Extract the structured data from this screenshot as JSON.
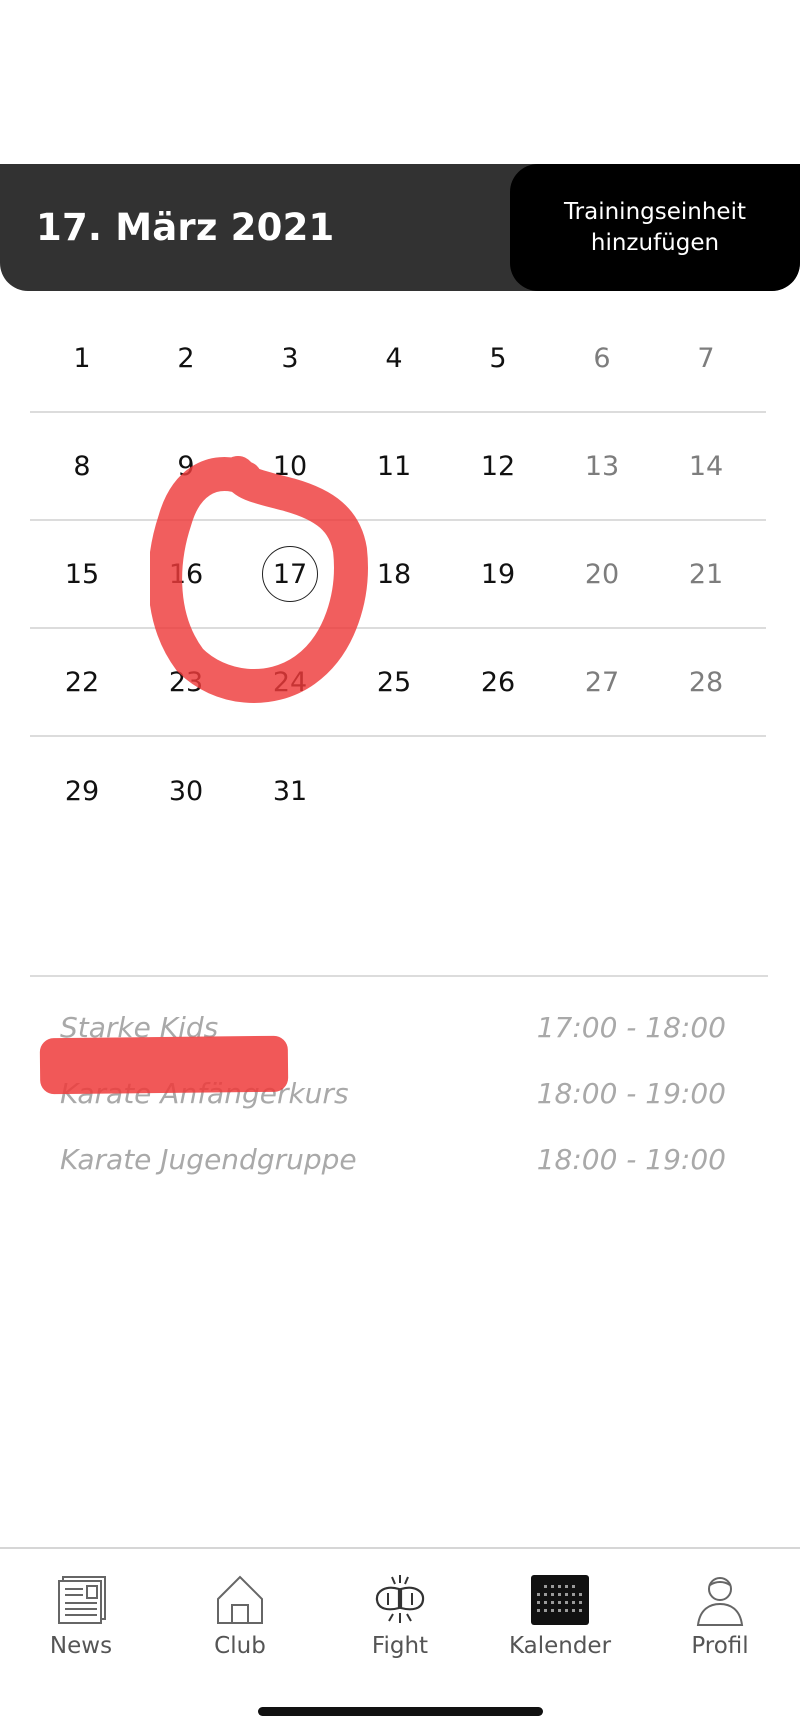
{
  "header": {
    "date_title": "17. März 2021",
    "add_button_line1": "Trainingseinheit",
    "add_button_line2": "hinzufügen"
  },
  "calendar": {
    "selected_day": "17",
    "weeks": [
      [
        "1",
        "2",
        "3",
        "4",
        "5",
        "6",
        "7"
      ],
      [
        "8",
        "9",
        "10",
        "11",
        "12",
        "13",
        "14"
      ],
      [
        "15",
        "16",
        "17",
        "18",
        "19",
        "20",
        "21"
      ],
      [
        "22",
        "23",
        "24",
        "25",
        "26",
        "27",
        "28"
      ],
      [
        "29",
        "30",
        "31",
        "",
        "",
        "",
        ""
      ]
    ]
  },
  "sessions": [
    {
      "name": "Starke Kids",
      "time": "17:00 - 18:00"
    },
    {
      "name": "Karate Anfängerkurs",
      "time": "18:00 - 19:00"
    },
    {
      "name": "Karate Jugendgruppe",
      "time": "18:00 - 19:00"
    }
  ],
  "tabbar": {
    "active": "Kalender",
    "items": [
      {
        "label": "News",
        "icon": "news-icon"
      },
      {
        "label": "Club",
        "icon": "home-icon"
      },
      {
        "label": "Fight",
        "icon": "boxing-gloves-icon"
      },
      {
        "label": "Kalender",
        "icon": "calendar-icon"
      },
      {
        "label": "Profil",
        "icon": "profile-icon"
      }
    ]
  },
  "colors": {
    "header_bg": "#323232",
    "button_bg": "#000000",
    "annotation_red": "#ee3b3b",
    "weekend_text": "#7d7d7d",
    "session_text": "#a9a9a9"
  }
}
